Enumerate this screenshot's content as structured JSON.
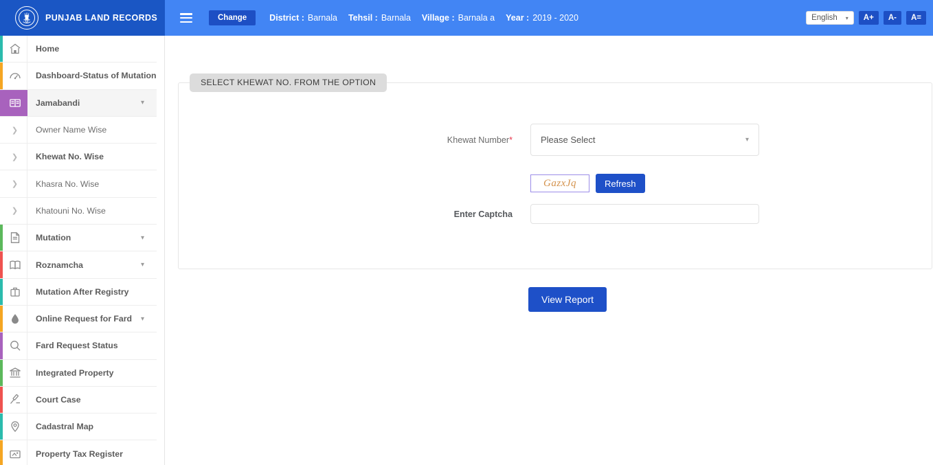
{
  "header": {
    "brand_title": "PUNJAB LAND RECORDS",
    "emblem_icon": "national-emblem-icon",
    "menu_icon": "hamburger-menu-icon",
    "change_label": "Change",
    "breadcrumb": {
      "district_key": "District :",
      "district_value": "Barnala",
      "tehsil_key": "Tehsil :",
      "tehsil_value": "Barnala",
      "village_key": "Village :",
      "village_value": "Barnala a",
      "year_key": "Year :",
      "year_value": "2019 - 2020"
    },
    "language": {
      "selected": "English",
      "caret_icon": "chevron-down-icon"
    },
    "font_buttons": [
      {
        "label": "A+",
        "name": "font-increase"
      },
      {
        "label": "A-",
        "name": "font-decrease"
      },
      {
        "label": "A=",
        "name": "font-reset"
      }
    ],
    "colors": {
      "header_blue": "#4285f4",
      "brand_blue": "#1a56c4",
      "button_blue": "#1d4fc4"
    }
  },
  "sidebar": {
    "items": [
      {
        "label": "Home",
        "icon": "home-icon",
        "accent": "#2bbbad",
        "type": "main",
        "bold": true,
        "caret": "",
        "active": false
      },
      {
        "label": "Dashboard-Status of Mutations",
        "icon": "dashboard-icon",
        "accent": "#f5a623",
        "type": "main",
        "bold": true,
        "caret": "",
        "active": false
      },
      {
        "label": "Jamabandi",
        "icon": "records-book-icon",
        "accent": "#a862bd",
        "type": "main",
        "bold": true,
        "caret": "ⱟ",
        "active": true
      },
      {
        "label": "Owner Name Wise",
        "icon": "chevron-right-icon",
        "accent": "",
        "type": "sub",
        "bold": false,
        "caret": "",
        "active": false
      },
      {
        "label": "Khewat No. Wise",
        "icon": "chevron-right-icon",
        "accent": "",
        "type": "sub",
        "bold": true,
        "caret": "",
        "active": false
      },
      {
        "label": "Khasra No. Wise",
        "icon": "chevron-right-icon",
        "accent": "",
        "type": "sub",
        "bold": false,
        "caret": "",
        "active": false
      },
      {
        "label": "Khatouni No. Wise",
        "icon": "chevron-right-icon",
        "accent": "",
        "type": "sub",
        "bold": false,
        "caret": "",
        "active": false
      },
      {
        "label": "Mutation",
        "icon": "document-icon",
        "accent": "#5cb85c",
        "type": "main",
        "bold": true,
        "caret": "ⱟ",
        "active": false
      },
      {
        "label": "Roznamcha",
        "icon": "book-icon",
        "accent": "#ef5350",
        "type": "main",
        "bold": true,
        "caret": "ⱟ",
        "active": false
      },
      {
        "label": "Mutation After Registry",
        "icon": "briefcase-icon",
        "accent": "#2bbbad",
        "type": "main",
        "bold": true,
        "caret": "",
        "active": false
      },
      {
        "label": "Online Request for Fard",
        "icon": "water-drop-icon",
        "accent": "#f5a623",
        "type": "main",
        "bold": true,
        "caret": "ⱟ",
        "active": false
      },
      {
        "label": "Fard Request Status",
        "icon": "search-icon",
        "accent": "#a862bd",
        "type": "main",
        "bold": true,
        "caret": "",
        "active": false
      },
      {
        "label": "Integrated Property",
        "icon": "bank-icon",
        "accent": "#5cb85c",
        "type": "main",
        "bold": true,
        "caret": "",
        "active": false
      },
      {
        "label": "Court Case",
        "icon": "gavel-icon",
        "accent": "#ef5350",
        "type": "main",
        "bold": true,
        "caret": "",
        "active": false
      },
      {
        "label": "Cadastral Map",
        "icon": "map-pin-icon",
        "accent": "#2bbbad",
        "type": "main",
        "bold": true,
        "caret": "",
        "active": false
      },
      {
        "label": "Property Tax Register",
        "icon": "property-tax-icon",
        "accent": "#f5a623",
        "type": "main",
        "bold": true,
        "caret": "",
        "active": false
      }
    ],
    "scrollbar": {
      "up_arrow_icon": "scroll-up-icon",
      "down_arrow_icon": "scroll-down-icon"
    }
  },
  "main": {
    "card_legend": "SELECT KHEWAT NO. FROM THE OPTION",
    "khewat": {
      "label": "Khewat Number",
      "required_marker": "*",
      "selected_value": "Please Select",
      "caret_icon": "chevron-down-icon"
    },
    "captcha": {
      "image_text": "GazxJq",
      "refresh_label": "Refresh",
      "input_label": "Enter Captcha",
      "input_value": "",
      "input_placeholder": ""
    },
    "submit_label": "View Report"
  }
}
